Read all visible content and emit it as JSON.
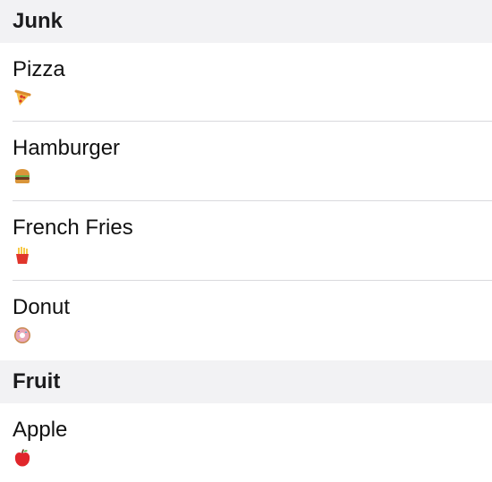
{
  "sections": [
    {
      "header": "Junk",
      "items": [
        {
          "title": "Pizza",
          "icon": "pizza-icon"
        },
        {
          "title": "Hamburger",
          "icon": "hamburger-icon"
        },
        {
          "title": "French Fries",
          "icon": "french-fries-icon"
        },
        {
          "title": "Donut",
          "icon": "donut-icon"
        }
      ]
    },
    {
      "header": "Fruit",
      "items": [
        {
          "title": "Apple",
          "icon": "apple-icon"
        }
      ]
    }
  ]
}
